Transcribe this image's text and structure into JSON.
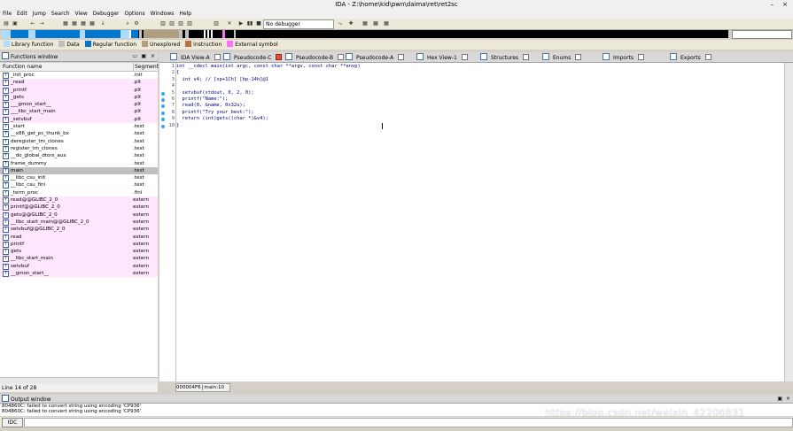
{
  "window": {
    "title": "IDA - Z:\\home\\kid\\pwn\\daima\\ret\\ret2sc"
  },
  "menu": [
    "File",
    "Edit",
    "Jump",
    "Search",
    "View",
    "Debugger",
    "Options",
    "Windows",
    "Help"
  ],
  "toolbar": {
    "debugger_select": "No debugger"
  },
  "legend": [
    {
      "label": "Library function",
      "color": "#aaddff"
    },
    {
      "label": "Data",
      "color": "#c0c0c0"
    },
    {
      "label": "Regular function",
      "color": "#0078d0"
    },
    {
      "label": "Unexplored",
      "color": "#b0a080"
    },
    {
      "label": "Instruction",
      "color": "#c07040"
    },
    {
      "label": "External symbol",
      "color": "#ff70ff"
    }
  ],
  "functions_window": {
    "title": "Functions window",
    "col_name": "Function name",
    "col_segment": "Segment",
    "rows": [
      {
        "name": "_init_proc",
        "segment": ".init",
        "style": "white"
      },
      {
        "name": "_read",
        "segment": ".plt",
        "style": "pink"
      },
      {
        "name": "_printf",
        "segment": ".plt",
        "style": "pink"
      },
      {
        "name": "_gets",
        "segment": ".plt",
        "style": "pink"
      },
      {
        "name": "___gmon_start__",
        "segment": ".plt",
        "style": "pink"
      },
      {
        "name": "___libc_start_main",
        "segment": ".plt",
        "style": "pink"
      },
      {
        "name": "_setvbuf",
        "segment": ".plt",
        "style": "pink"
      },
      {
        "name": "_start",
        "segment": ".text",
        "style": "white"
      },
      {
        "name": "__x86_get_pc_thunk_bx",
        "segment": ".text",
        "style": "white"
      },
      {
        "name": "deregister_tm_clones",
        "segment": ".text",
        "style": "white"
      },
      {
        "name": "register_tm_clones",
        "segment": ".text",
        "style": "white"
      },
      {
        "name": "__do_global_dtors_aux",
        "segment": ".text",
        "style": "white"
      },
      {
        "name": "frame_dummy",
        "segment": ".text",
        "style": "white"
      },
      {
        "name": "main",
        "segment": ".text",
        "style": "selected"
      },
      {
        "name": "__libc_csu_init",
        "segment": ".text",
        "style": "white"
      },
      {
        "name": "__libc_csu_fini",
        "segment": ".text",
        "style": "white"
      },
      {
        "name": "_term_proc",
        "segment": ".fini",
        "style": "white"
      },
      {
        "name": "read@@GLIBC_2_0",
        "segment": "extern",
        "style": "pink"
      },
      {
        "name": "printf@@GLIBC_2_0",
        "segment": "extern",
        "style": "pink"
      },
      {
        "name": "gets@@GLIBC_2_0",
        "segment": "extern",
        "style": "pink"
      },
      {
        "name": "__libc_start_main@@GLIBC_2_0",
        "segment": "extern",
        "style": "pink"
      },
      {
        "name": "setvbuf@@GLIBC_2_0",
        "segment": "extern",
        "style": "pink"
      },
      {
        "name": "read",
        "segment": "extern",
        "style": "pink"
      },
      {
        "name": "printf",
        "segment": "extern",
        "style": "pink"
      },
      {
        "name": "gets",
        "segment": "extern",
        "style": "pink"
      },
      {
        "name": "__libc_start_main",
        "segment": "extern",
        "style": "pink"
      },
      {
        "name": "setvbuf",
        "segment": "extern",
        "style": "pink"
      },
      {
        "name": "__gmon_start__",
        "segment": "extern",
        "style": "pink"
      }
    ],
    "status": "Line 14 of 28"
  },
  "tabs": [
    {
      "label": "IDA View-A",
      "active": false
    },
    {
      "label": "Pseudocode-C",
      "active": true
    },
    {
      "label": "Pseudocode-B",
      "active": false
    },
    {
      "label": "Pseudocode-A",
      "active": false
    },
    {
      "label": "Hex View-1",
      "active": false
    },
    {
      "label": "Structures",
      "active": false
    },
    {
      "label": "Enums",
      "active": false
    },
    {
      "label": "Imports",
      "active": false
    },
    {
      "label": "Exports",
      "active": false
    }
  ],
  "pseudocode": {
    "lines": [
      {
        "num": "1",
        "dot": false,
        "text": "int __cdecl main(int argc, const char **argv, const char **envp)"
      },
      {
        "num": "2",
        "dot": false,
        "text": "{"
      },
      {
        "num": "3",
        "dot": false,
        "text": "  int v4; // [sp+1Ch] [bp-14h]@1"
      },
      {
        "num": "4",
        "dot": false,
        "text": ""
      },
      {
        "num": "5",
        "dot": true,
        "text": "  setvbuf(stdout, 0, 2, 0);"
      },
      {
        "num": "6",
        "dot": true,
        "text": "  printf(\"Name:\");"
      },
      {
        "num": "7",
        "dot": true,
        "text": "  read(0, &name, 0x32u);"
      },
      {
        "num": "8",
        "dot": true,
        "text": "  printf(\"Try your best:\");"
      },
      {
        "num": "9",
        "dot": true,
        "text": "  return (int)gets((char *)&v4);"
      },
      {
        "num": "10",
        "dot": true,
        "text": "}"
      }
    ],
    "status_address": "000004F6",
    "status_location": "main:10"
  },
  "output_window": {
    "title": "Output window",
    "lines": [
      "804860C: failed to convert string using encoding 'CP936'",
      "804860C: failed to convert string using encoding 'CP936'"
    ]
  },
  "idc": {
    "button_label": "IDC"
  },
  "watermark": "https://blog.csdn.net/weixin_42206831"
}
